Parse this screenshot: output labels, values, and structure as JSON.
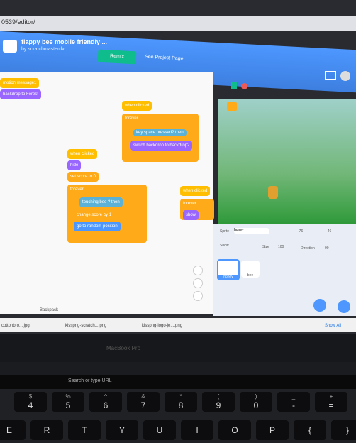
{
  "browser": {
    "url": "0539/editor/"
  },
  "header": {
    "project_title": "flappy bee mobile friendly ...",
    "project_by": "by scratchmasterdv",
    "remix_label": "Remix",
    "see_project_label": "See Project Page"
  },
  "blocks": {
    "b1": "motion message1",
    "b2": "backdrop to Forest",
    "hat1": "when clicked",
    "forever1": "forever",
    "if1": "key space pressed? then",
    "switch_backdrop": "switch backdrop to backdrop2",
    "hat2": "when clicked",
    "hide": "hide",
    "set_score": "set score to 0",
    "forever2": "forever",
    "touching": "touching bee ? then",
    "change_score": "change score by 1",
    "goto": "go to random position",
    "hat3": "when clicked",
    "forever3": "forever",
    "show": "show"
  },
  "workspace": {
    "backpack_label": "Backpack"
  },
  "sprite_pane": {
    "sprite_label": "Sprite",
    "sprite_name": "honey",
    "show_label": "Show",
    "size_label": "Size",
    "size_value": "100",
    "direction_label": "Direction",
    "direction_value": "90",
    "x_value": "-76",
    "y_value": "-46",
    "thumbs": [
      "honey",
      "bee"
    ]
  },
  "downloads": {
    "items": [
      "cottonbro....jpg",
      "kisspng-scratch....png",
      "kisspng-logo-je....png"
    ],
    "show_all": "Show All"
  },
  "laptop": {
    "brand": "MacBook Pro",
    "touchbar_search": "Search or type URL"
  },
  "keyboard": {
    "top_row": [
      {
        "sym": "$",
        "num": "4"
      },
      {
        "sym": "%",
        "num": "5"
      },
      {
        "sym": "^",
        "num": "6"
      },
      {
        "sym": "&",
        "num": "7"
      },
      {
        "sym": "*",
        "num": "8"
      },
      {
        "sym": "(",
        "num": "9"
      },
      {
        "sym": ")",
        "num": "0"
      },
      {
        "sym": "_",
        "num": "-"
      },
      {
        "sym": "+",
        "num": "="
      }
    ],
    "letters": [
      "E",
      "R",
      "T",
      "Y",
      "U",
      "I",
      "O",
      "P",
      "{",
      "}"
    ]
  },
  "colors": {
    "scratch_blue": "#4d97ff",
    "remix_green": "#0fbd8c",
    "events_yellow": "#ffbf00",
    "looks_purple": "#9966ff"
  }
}
